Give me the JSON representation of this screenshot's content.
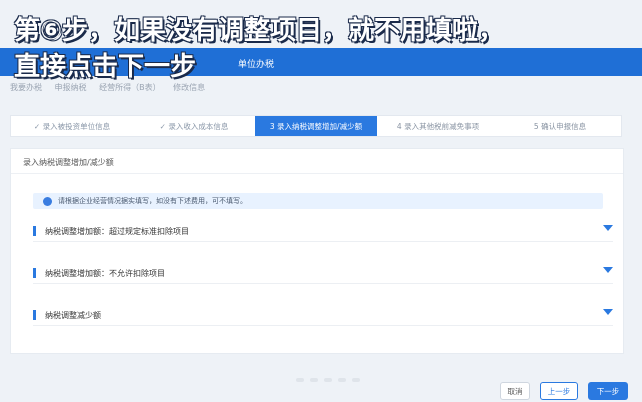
{
  "overlay": {
    "line1": "第⑥步，如果没有调整项目，就不用填啦，",
    "line2": "直接点击下一步"
  },
  "topbar": {
    "left_text": "单位办税"
  },
  "breadcrumb": [
    "我要办税",
    "申报纳税",
    "经营所得（B表）",
    "修改信息"
  ],
  "steps": [
    {
      "label": "✓ 录入被投资单位信息",
      "state": "done"
    },
    {
      "label": "✓ 录入收入成本信息",
      "state": "done"
    },
    {
      "label": "3  录入纳税调整增加/减少额",
      "state": "active"
    },
    {
      "label": "4  录入其他税前减免事项",
      "state": "todo"
    },
    {
      "label": "5  确认申报信息",
      "state": "todo"
    }
  ],
  "panel": {
    "title": "录入纳税调整增加/减少额",
    "notice": "请根据企业经营情况据实填写，如没有下述费用，可不填写。",
    "sections": [
      "纳税调整增加额：超过规定标准扣除项目",
      "纳税调整增加额：不允许扣除项目",
      "纳税调整减少额"
    ]
  },
  "buttons": {
    "cancel": "取消",
    "prev": "上一步",
    "next": "下一步"
  },
  "colors": {
    "accent": "#2a79e0",
    "topbar": "#1f6fd6",
    "notice_bg": "#e8f2ff"
  }
}
